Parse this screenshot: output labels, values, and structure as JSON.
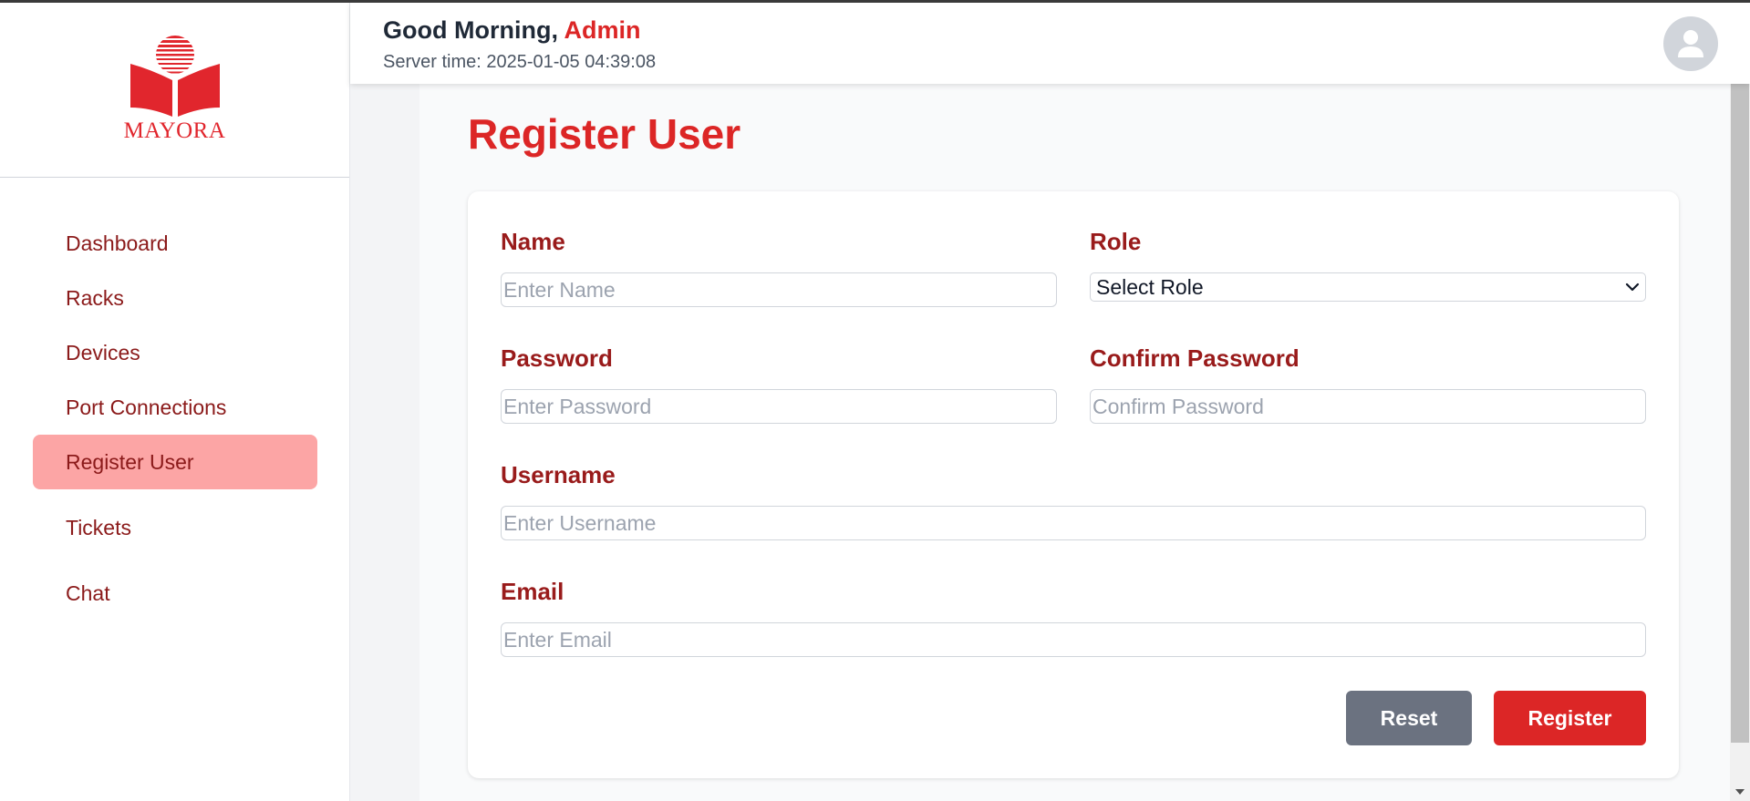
{
  "app": {
    "brand": "MAYORA"
  },
  "sidebar": {
    "items": [
      {
        "label": "Dashboard"
      },
      {
        "label": "Racks"
      },
      {
        "label": "Devices"
      },
      {
        "label": "Port Connections"
      },
      {
        "label": "Register User",
        "active": true
      },
      {
        "label": "Tickets"
      },
      {
        "label": "Chat"
      }
    ]
  },
  "header": {
    "greeting_prefix": "Good Morning, ",
    "greeting_name": "Admin",
    "server_time": "Server time: 2025-01-05 04:39:08",
    "avatar_icon": "user-icon"
  },
  "main": {
    "title": "Register User",
    "form": {
      "name_label": "Name",
      "name_placeholder": "Enter Name",
      "role_label": "Role",
      "role_selected": "Select Role",
      "password_label": "Password",
      "password_placeholder": "Enter Password",
      "confirm_label": "Confirm Password",
      "confirm_placeholder": "Confirm Password",
      "username_label": "Username",
      "username_placeholder": "Enter Username",
      "email_label": "Email",
      "email_placeholder": "Enter Email",
      "reset_label": "Reset",
      "register_label": "Register"
    }
  },
  "colors": {
    "accent": "#dc2626",
    "label": "#991b1b",
    "nav_text": "#8b1a1a",
    "nav_active_bg": "#fca5a5",
    "reset_bg": "#6b7280"
  }
}
